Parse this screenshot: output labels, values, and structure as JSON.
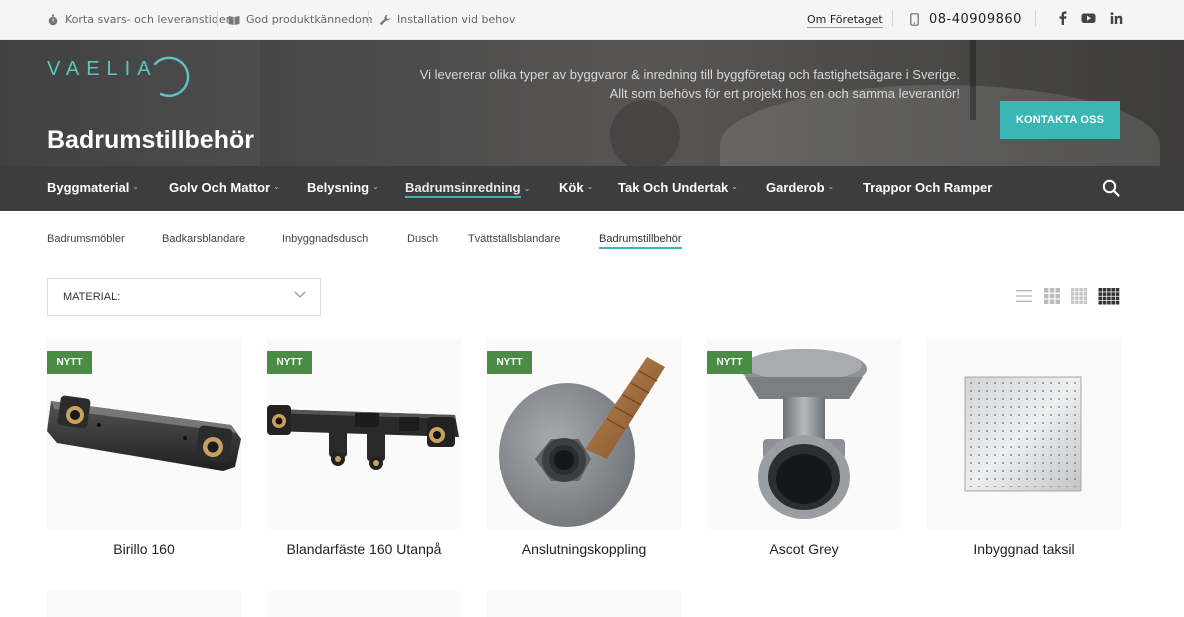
{
  "topbar": {
    "features": [
      {
        "icon": "stopwatch-icon",
        "label": "Korta svars- och leveranstiden"
      },
      {
        "icon": "book-icon",
        "label": "God produktkännedom"
      },
      {
        "icon": "wrench-icon",
        "label": "Installation vid behov"
      }
    ],
    "about_link": "Om Företaget",
    "phone": "08-40909860",
    "social": [
      "facebook-icon",
      "youtube-icon",
      "linkedin-icon"
    ]
  },
  "hero": {
    "logo_text": "VAELIA",
    "page_title": "Badrumstillbehör",
    "tagline_line1": "Vi levererar olika typer av byggvaror & inredning till byggföretag och fastighetsägare i Sverige.",
    "tagline_line2": "Allt som behövs för ert projekt hos en och samma leverantör!",
    "cta_label": "KONTAKTA OSS"
  },
  "nav": {
    "items": [
      {
        "label": "Byggmaterial",
        "dropdown": true
      },
      {
        "label": "Golv Och Mattor",
        "dropdown": true
      },
      {
        "label": "Belysning",
        "dropdown": true
      },
      {
        "label": "Badrumsinredning",
        "dropdown": true,
        "active": true
      },
      {
        "label": "Kök",
        "dropdown": true
      },
      {
        "label": "Tak Och Undertak",
        "dropdown": true
      },
      {
        "label": "Garderob",
        "dropdown": true
      },
      {
        "label": "Trappor Och Ramper",
        "dropdown": false
      }
    ]
  },
  "subnav": {
    "items": [
      "Badrumsmöbler",
      "Badkarsblandare",
      "Inbyggnadsdusch",
      "Dusch",
      "Tvättställsblandare",
      "Badrumstillbehör"
    ],
    "active": "Badrumstillbehör"
  },
  "filter": {
    "label": "MATERIAL:"
  },
  "products": [
    {
      "name": "Birillo 160",
      "badge": "NYTT"
    },
    {
      "name": "Blandarfäste 160 Utanpå",
      "badge": "NYTT"
    },
    {
      "name": "Anslutningskoppling",
      "badge": "NYTT"
    },
    {
      "name": "Ascot Grey",
      "badge": "NYTT"
    },
    {
      "name": "Inbyggnad taksil",
      "badge": ""
    }
  ],
  "colors": {
    "accent": "#3ab7b4",
    "badge": "#4a8b46",
    "nav_bg": "#3d3d3d"
  }
}
